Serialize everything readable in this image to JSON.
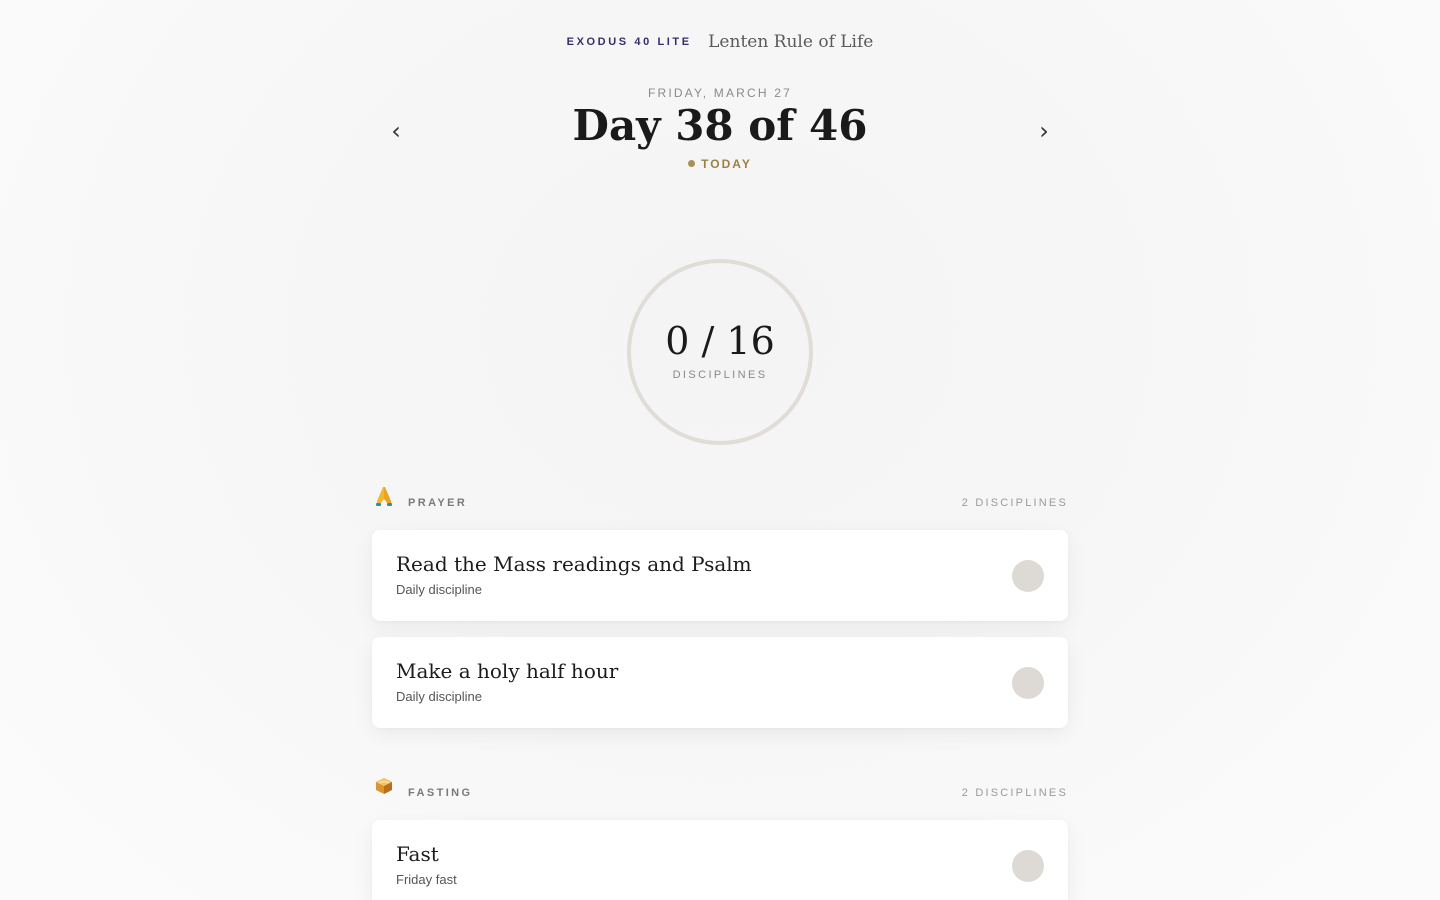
{
  "header": {
    "app_name": "EXODUS 40 LITE",
    "title": "Lenten Rule of Life",
    "date": "FRIDAY, MARCH 27",
    "day_title": "Day 38 of 46",
    "today_label": "TODAY",
    "prev_icon": "chevron-left-icon",
    "next_icon": "chevron-right-icon",
    "accent_color": "#a98f56"
  },
  "progress": {
    "count": "0 / 16",
    "label": "DISCIPLINES",
    "completed": 0,
    "total": 16
  },
  "sections": [
    {
      "name": "PRAYER",
      "icon": "praying-hands-icon",
      "count": "2 DISCIPLINES",
      "items": [
        {
          "title": "Read the Mass readings and Psalm",
          "subtitle": "Daily discipline"
        },
        {
          "title": "Make a holy half hour",
          "subtitle": "Daily discipline"
        }
      ]
    },
    {
      "name": "FASTING",
      "icon": "bread-icon",
      "count": "2 DISCIPLINES",
      "items": [
        {
          "title": "Fast",
          "subtitle": "Friday fast"
        }
      ]
    }
  ]
}
